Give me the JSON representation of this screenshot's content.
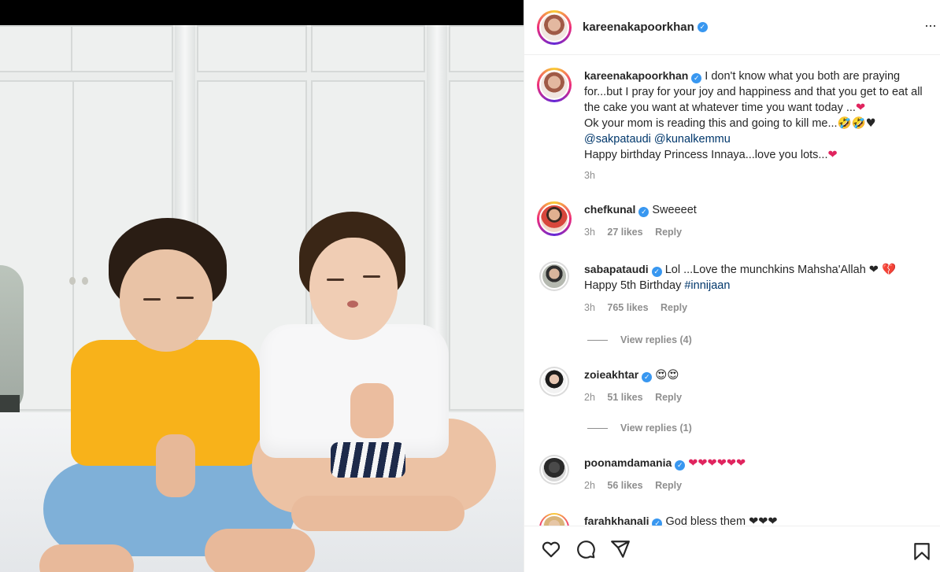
{
  "post": {
    "author": "kareenakapoorkhan",
    "caption_lines": [
      "I don't know what you both are praying for...but I pray for your joy and happiness and that you get to eat all the cake you want at whatever time you want today ...",
      "Ok your mom is reading this and going to kill me...",
      "@sakpataudi @kunalkemmu",
      "Happy birthday Princess Innaya...love you lots..."
    ],
    "caption_emojis": {
      "line1_end": "❤",
      "line2_end": "🤣🤣♥",
      "line4_end": "❤"
    },
    "time": "3h"
  },
  "comments": [
    {
      "user": "chefkunal",
      "text": "Sweeeet",
      "time": "3h",
      "likes": "27 likes",
      "reply": "Reply"
    },
    {
      "user": "sabapataudi",
      "text": "Lol ...Love the munchkins Mahsha'Allah ❤ 💔",
      "text2_prefix": "Happy 5th Birthday ",
      "hashtag": "#innijaan",
      "time": "3h",
      "likes": "765 likes",
      "reply": "Reply",
      "view_replies": "View replies (4)"
    },
    {
      "user": "zoieakhtar",
      "text": "😍😍",
      "time": "2h",
      "likes": "51 likes",
      "reply": "Reply",
      "view_replies": "View replies (1)"
    },
    {
      "user": "poonamdamania",
      "text": "❤❤❤❤❤❤",
      "time": "2h",
      "likes": "56 likes",
      "reply": "Reply"
    },
    {
      "user": "farahkhanali",
      "text": "God bless them ❤❤❤"
    }
  ],
  "icons": {
    "verified": "verified-badge",
    "like": "heart-icon",
    "comment": "comment-icon",
    "share": "share-icon",
    "save": "bookmark-icon"
  },
  "colors": {
    "accent": "#3897f0",
    "heart": "#e0245e",
    "mention": "#00376b"
  }
}
